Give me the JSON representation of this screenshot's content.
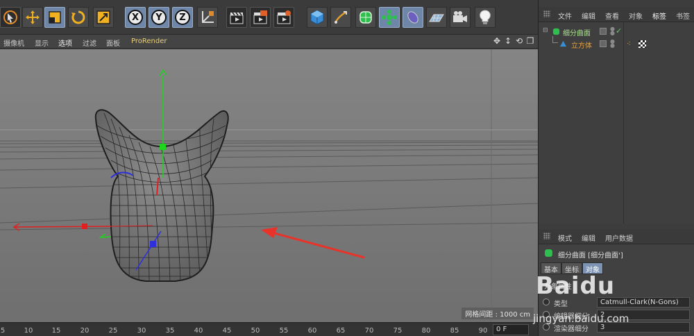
{
  "viewport_menu": {
    "items": [
      "摄像机",
      "显示",
      "选项",
      "过滤",
      "面板",
      "ProRender"
    ]
  },
  "viewport": {
    "grid_spacing": "网格间距 : 1000 cm"
  },
  "timeline": {
    "ticks": [
      "5",
      "10",
      "15",
      "20",
      "25",
      "30",
      "35",
      "40",
      "45",
      "50",
      "55",
      "60",
      "65",
      "70",
      "75",
      "80",
      "85",
      "90"
    ],
    "frame_value": "0 F"
  },
  "object_manager": {
    "menu": [
      "文件",
      "编辑",
      "查看",
      "对象",
      "标签",
      "书签"
    ],
    "objects": [
      {
        "name": "细分曲面",
        "color": "#a6e08a"
      },
      {
        "name": "立方体",
        "color": "#e8a23c"
      }
    ]
  },
  "attribute_manager": {
    "menu": [
      "模式",
      "编辑",
      "用户数据"
    ],
    "object_title": "细分曲面 [细分曲面']",
    "tabs": [
      "基本",
      "坐标",
      "对象"
    ],
    "section": "对象属性",
    "properties": [
      {
        "label": "类型",
        "value": "Catmull-Clark(N-Gons)"
      },
      {
        "label": "编辑器细分",
        "value": "2"
      },
      {
        "label": "渲染器细分",
        "value": "3"
      }
    ]
  },
  "watermark": {
    "brand": "Baidu",
    "url": "jingyan.baidu.com"
  },
  "colors": {
    "accent_active": "#6e86a8",
    "viewport_bg": "#7a7a7a",
    "axis_y": "#1dd61d",
    "axis_x": "#e02020",
    "axis_z": "#2f2fdc",
    "annotation_arrow": "#e8332a"
  }
}
